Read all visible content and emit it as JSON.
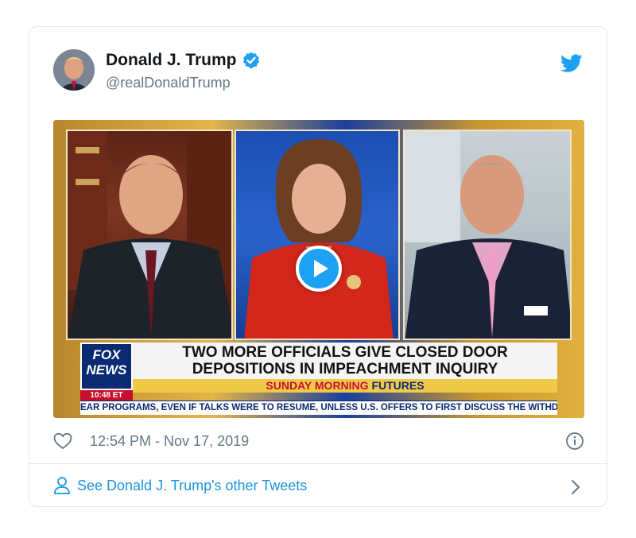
{
  "tweet": {
    "author": {
      "display_name": "Donald J. Trump",
      "handle": "@realDonaldTrump",
      "verified": true
    },
    "timestamp": "12:54 PM - Nov 17, 2019"
  },
  "media": {
    "type": "video",
    "network_logo_line1": "FOX",
    "network_logo_line2": "NEWS",
    "clock": "10:48 ET",
    "headline_line1": "TWO MORE OFFICIALS GIVE CLOSED DOOR",
    "headline_line2": "DEPOSITIONS IN IMPEACHMENT INQUIRY",
    "show_name_part1": "SUNDAY MORNING",
    "show_name_part2": "FUTURES",
    "ticker": "EAR PROGRAMS, EVEN IF TALKS WERE TO RESUME, UNLESS U.S. OFFERS TO FIRST DISCUSS THE WITHDRAW"
  },
  "footer": {
    "link_label": "See Donald J. Trump's other Tweets"
  },
  "colors": {
    "twitter_blue": "#1da1f2",
    "link_blue": "#1b95e0",
    "muted_text": "#657786",
    "border": "#e1e8ed"
  },
  "icons": [
    "twitter-bird-icon",
    "verified-badge-icon",
    "play-icon",
    "heart-icon",
    "info-icon",
    "person-icon",
    "chevron-right-icon"
  ]
}
